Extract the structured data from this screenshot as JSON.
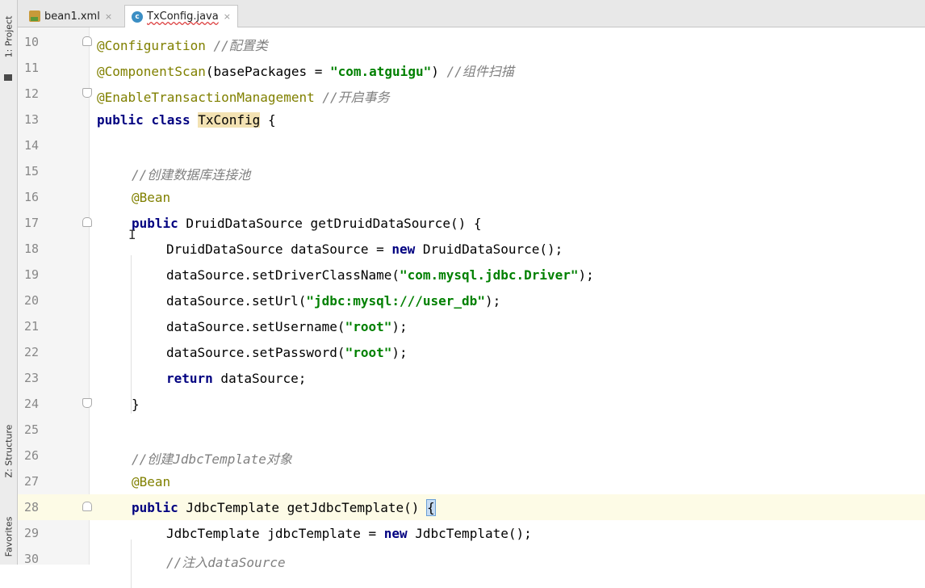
{
  "sidebar": {
    "tabs": [
      {
        "label": "1: Project"
      },
      {
        "label": "Z: Structure"
      },
      {
        "label": "Favorites"
      }
    ]
  },
  "tabs": [
    {
      "label": "bean1.xml",
      "icon": "xml-file-icon",
      "active": false
    },
    {
      "label": "TxConfig.java",
      "icon": "java-class-icon",
      "active": true
    }
  ],
  "close_glyph": "×",
  "editor": {
    "lines": [
      {
        "n": "10",
        "indent": 0,
        "tokens": [
          [
            "ann",
            "@Configuration"
          ],
          [
            "t",
            " "
          ],
          [
            "cm",
            "//配置类"
          ]
        ]
      },
      {
        "n": "11",
        "indent": 0,
        "tokens": [
          [
            "ann",
            "@ComponentScan"
          ],
          [
            "t",
            "(basePackages = "
          ],
          [
            "str",
            "\"com.atguigu\""
          ],
          [
            "t",
            ") "
          ],
          [
            "cm",
            "//组件扫描"
          ]
        ]
      },
      {
        "n": "12",
        "indent": 0,
        "tokens": [
          [
            "ann",
            "@EnableTransactionManagement"
          ],
          [
            "t",
            " "
          ],
          [
            "cm",
            "//开启事务"
          ]
        ]
      },
      {
        "n": "13",
        "indent": 0,
        "tokens": [
          [
            "kw",
            "public"
          ],
          [
            "t",
            " "
          ],
          [
            "kw",
            "class"
          ],
          [
            "t",
            " "
          ],
          [
            "hl",
            "TxConfig"
          ],
          [
            "t",
            " {"
          ]
        ]
      },
      {
        "n": "14",
        "indent": 0,
        "tokens": []
      },
      {
        "n": "15",
        "indent": 1,
        "tokens": [
          [
            "cm",
            "//创建数据库连接池"
          ]
        ]
      },
      {
        "n": "16",
        "indent": 1,
        "tokens": [
          [
            "ann",
            "@Bean"
          ]
        ]
      },
      {
        "n": "17",
        "indent": 1,
        "tokens": [
          [
            "kw",
            "public"
          ],
          [
            "t",
            " DruidDataSource getDruidDataSource() {"
          ]
        ]
      },
      {
        "n": "18",
        "indent": 2,
        "tokens": [
          [
            "t",
            "DruidDataSource dataSource = "
          ],
          [
            "kw",
            "new"
          ],
          [
            "t",
            " DruidDataSource();"
          ]
        ]
      },
      {
        "n": "19",
        "indent": 2,
        "tokens": [
          [
            "t",
            "dataSource.setDriverClassName("
          ],
          [
            "str",
            "\"com.mysql.jdbc.Driver\""
          ],
          [
            "t",
            ");"
          ]
        ]
      },
      {
        "n": "20",
        "indent": 2,
        "tokens": [
          [
            "t",
            "dataSource.setUrl("
          ],
          [
            "str",
            "\"jdbc:mysql:///user_db\""
          ],
          [
            "t",
            ");"
          ]
        ]
      },
      {
        "n": "21",
        "indent": 2,
        "tokens": [
          [
            "t",
            "dataSource.setUsername("
          ],
          [
            "str",
            "\"root\""
          ],
          [
            "t",
            ");"
          ]
        ]
      },
      {
        "n": "22",
        "indent": 2,
        "tokens": [
          [
            "t",
            "dataSource.setPassword("
          ],
          [
            "str",
            "\"root\""
          ],
          [
            "t",
            ");"
          ]
        ]
      },
      {
        "n": "23",
        "indent": 2,
        "tokens": [
          [
            "kw",
            "return"
          ],
          [
            "t",
            " dataSource;"
          ]
        ]
      },
      {
        "n": "24",
        "indent": 1,
        "tokens": [
          [
            "t",
            "}"
          ]
        ]
      },
      {
        "n": "25",
        "indent": 0,
        "tokens": []
      },
      {
        "n": "26",
        "indent": 1,
        "tokens": [
          [
            "cm",
            "//创建JdbcTemplate对象"
          ]
        ]
      },
      {
        "n": "27",
        "indent": 1,
        "tokens": [
          [
            "ann",
            "@Bean"
          ]
        ]
      },
      {
        "n": "28",
        "indent": 1,
        "tokens": [
          [
            "kw",
            "public"
          ],
          [
            "t",
            " JdbcTemplate getJdbcTemplate() "
          ],
          [
            "bh",
            "{"
          ]
        ],
        "current": true
      },
      {
        "n": "29",
        "indent": 2,
        "tokens": [
          [
            "t",
            "JdbcTemplate jdbcTemplate = "
          ],
          [
            "kw",
            "new"
          ],
          [
            "t",
            " JdbcTemplate();"
          ]
        ]
      },
      {
        "n": "30",
        "indent": 2,
        "tokens": [
          [
            "cm",
            "//注入dataSource"
          ]
        ]
      }
    ],
    "fold_markers": {
      "10": "start",
      "12": "end",
      "17": "start",
      "24": "end",
      "28": "start"
    }
  }
}
